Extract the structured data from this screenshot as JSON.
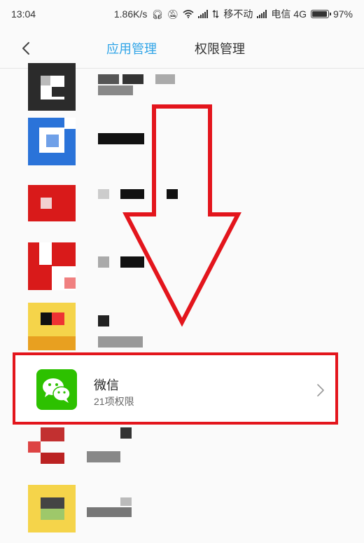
{
  "status_bar": {
    "time": "13:04",
    "speed": "1.86K/s",
    "carrier1": "移不动",
    "carrier2": "电信 4G",
    "battery": "97%",
    "battery_level": 0.97,
    "icons": [
      "headphones-icon",
      "mute-icon",
      "wifi-icon",
      "signal-icon",
      "data-arrows-icon",
      "signal-icon",
      "battery-icon"
    ]
  },
  "nav": {
    "back_icon": "chevron-left-icon",
    "tabs": [
      {
        "label": "应用管理",
        "active": true
      },
      {
        "label": "权限管理",
        "active": false
      }
    ],
    "accent": "#2fa4e7"
  },
  "highlighted_app": {
    "name": "微信",
    "permissions": "21项权限",
    "icon": "wechat-icon",
    "chevron": "chevron-right-icon",
    "highlight_color": "#e3151c",
    "icon_color": "#2dc100"
  },
  "annotation": {
    "arrow_color": "#e3151c",
    "arrow_icon": "down-arrow-icon"
  }
}
